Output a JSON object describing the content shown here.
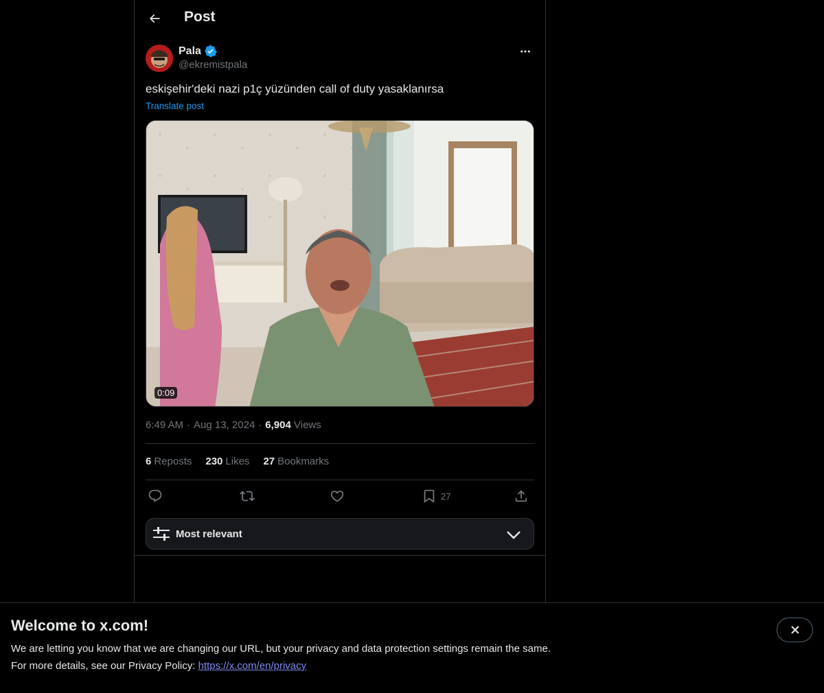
{
  "header": {
    "title": "Post"
  },
  "post": {
    "author_name": "Pala",
    "author_handle": "@ekremistpala",
    "text": "eskişehir'deki nazi p1ç yüzünden call of duty yasaklanırsa",
    "translate_label": "Translate post",
    "media": {
      "duration": "0:09"
    },
    "time": "6:49 AM",
    "separator": "·",
    "date": "Aug 13, 2024",
    "views_count": "6,904",
    "views_label": "Views"
  },
  "stats": {
    "reposts_count": "6",
    "reposts_label": "Reposts",
    "likes_count": "230",
    "likes_label": "Likes",
    "bookmarks_count": "27",
    "bookmarks_label": "Bookmarks"
  },
  "actions": {
    "bookmark_count": "27",
    "icons": [
      "reply-icon",
      "repost-icon",
      "like-icon",
      "bookmark-icon",
      "share-icon"
    ]
  },
  "sort": {
    "label": "Most relevant"
  },
  "banner": {
    "title": "Welcome to x.com!",
    "line1": "We are letting you know that we are changing our URL, but your privacy and data protection settings remain the same.",
    "line2_prefix": "For more details, see our Privacy Policy: ",
    "link": "https://x.com/en/privacy"
  },
  "colors": {
    "background": "#000000",
    "accent": "#1d9bf0",
    "text_primary": "#e7e9ea",
    "text_secondary": "#71767b",
    "border": "#2f3336",
    "link": "#7f8cf0"
  }
}
